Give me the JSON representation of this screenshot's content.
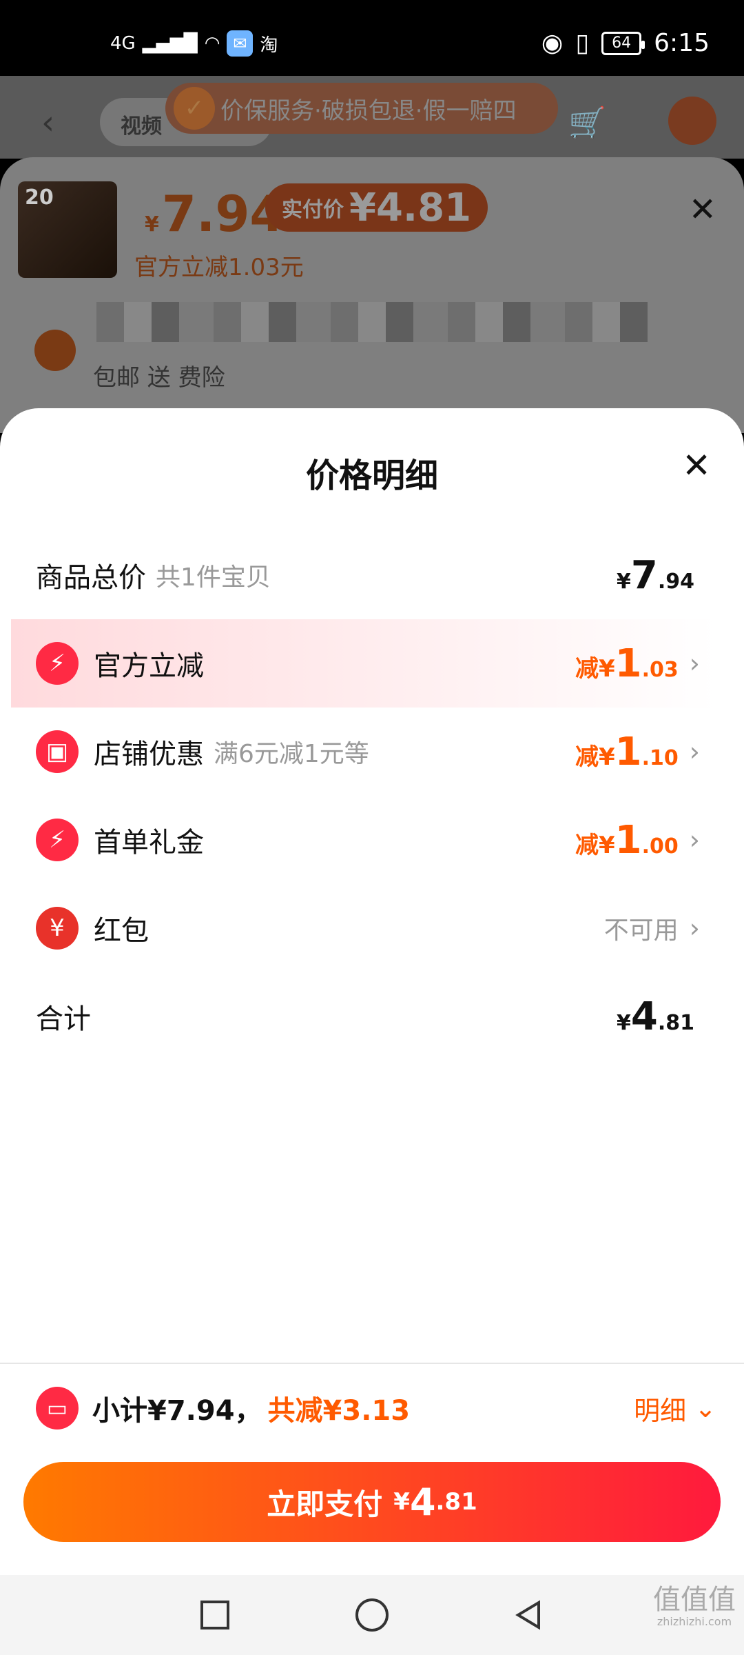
{
  "status_bar": {
    "network": "4G",
    "app_badge": "淘",
    "battery": "64",
    "time": "6:15"
  },
  "product_header": {
    "back_icon": "‹",
    "tab_label": "视频",
    "guarantee_banner": "价保服务·破损包退·假一赔四",
    "thumb_badge": "20",
    "currency": "¥",
    "price": "7.94",
    "actual_label": "实付价",
    "actual_price": "¥4.81",
    "discount_note": "官方立减1.03元",
    "shipping": "包邮 送 费险"
  },
  "detail_sheet": {
    "title": "价格明细",
    "rows": [
      {
        "label": "商品总价",
        "sub": "共1件宝贝",
        "currency": "¥",
        "big": "7",
        "small": ".94"
      },
      {
        "icon": "⚡",
        "label": "官方立减",
        "prefix": "减¥",
        "big": "1",
        "small": ".03"
      },
      {
        "icon": "▣",
        "label": "店铺优惠",
        "sub": "满6元减1元等",
        "prefix": "减¥",
        "big": "1",
        "small": ".10"
      },
      {
        "icon": "⚡",
        "label": "首单礼金",
        "prefix": "减¥",
        "big": "1",
        "small": ".00"
      },
      {
        "icon": "¥",
        "label": "红包",
        "status": "不可用"
      },
      {
        "label": "合计",
        "currency": "¥",
        "big": "4",
        "small": ".81"
      }
    ]
  },
  "summary": {
    "subtotal": "小计¥7.94，",
    "saved": "共减¥3.13",
    "detail_link": "明细"
  },
  "pay_button": {
    "label": "立即支付",
    "currency": "¥",
    "big": "4",
    "small": ".81"
  },
  "watermark": {
    "glyphs": "值值值",
    "domain": "zhizhizhi.com"
  },
  "colors": {
    "accent": "#ff5a00",
    "brand_red": "#ff1a3d",
    "highlight": "#ffdadd"
  }
}
